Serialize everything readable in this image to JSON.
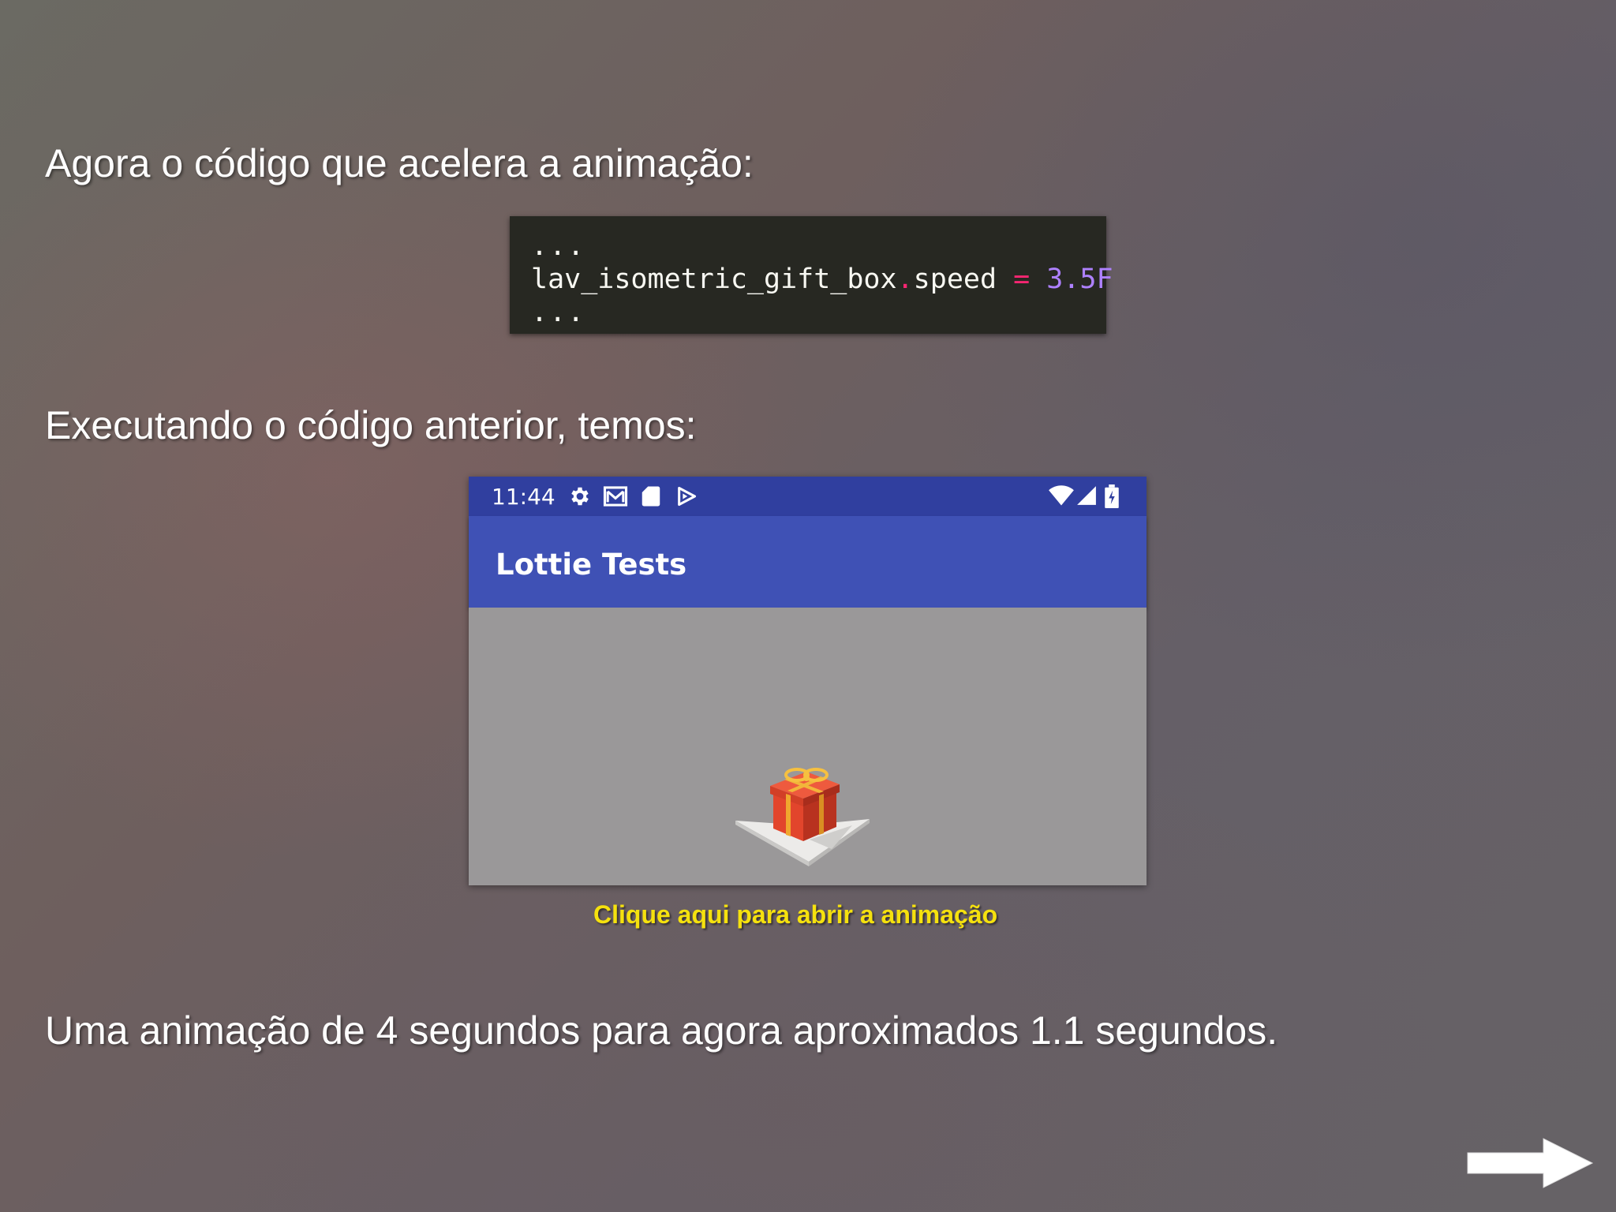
{
  "slide": {
    "heading_1": "Agora o código que acelera a animação:",
    "heading_2": "Executando o código anterior, temos:",
    "summary": "Uma animação de 4 segundos para agora aproximados 1.1 segundos.",
    "link_text": "Clique aqui para abrir a animação",
    "next_icon": "arrow-right-icon"
  },
  "code": {
    "ellipsis_top": "...",
    "object": "lav_isometric_gift_box",
    "dot": ".",
    "property": "speed",
    "operator": "=",
    "value": "3.5F",
    "ellipsis_bottom": "..."
  },
  "phone": {
    "status_time": "11:44",
    "status_icons_left": [
      "settings-icon",
      "gmail-icon",
      "sd-card-icon",
      "play-store-icon"
    ],
    "status_icons_right": [
      "wifi-icon",
      "cell-signal-icon",
      "battery-charging-icon"
    ],
    "app_title": "Lottie Tests",
    "content_icon": "gift-box-icon"
  },
  "colors": {
    "status_bar": "#303f9f",
    "app_bar": "#3f51b5",
    "link": "#f5e10e",
    "code_bg": "#272822"
  }
}
